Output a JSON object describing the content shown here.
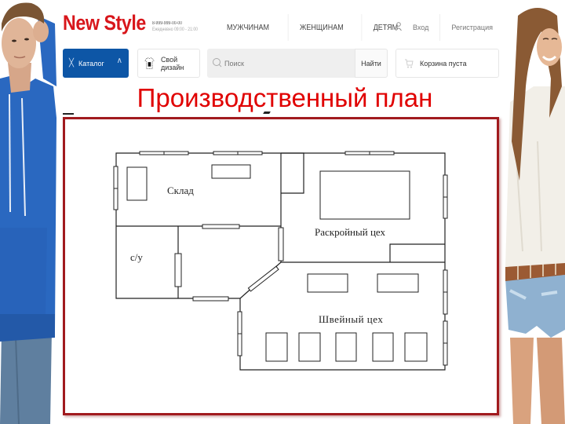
{
  "site": {
    "logo": "New Style",
    "phone": "8-999-999-00-00",
    "hours": "Ежедневно 09:00 - 21:00",
    "nav": [
      "МУЖЧИНАМ",
      "ЖЕНЩИНАМ",
      "ДЕТЯМ"
    ],
    "login_label": "Вход",
    "register_label": "Регистрация",
    "catalog_label": "Каталог",
    "design_label": "Свой дизайн",
    "search_placeholder": "Поиск",
    "search_button": "Найти",
    "cart_label": "Корзина пуста",
    "accent": "#d8161b",
    "catalog_bg": "#0d56a6"
  },
  "slide": {
    "title": "Производственный план",
    "title_color": "#e00000",
    "frame_color": "#a11a1e"
  },
  "plan": {
    "rooms": [
      {
        "id": "warehouse",
        "label": "Склад"
      },
      {
        "id": "cutting",
        "label": "Раскройный цех"
      },
      {
        "id": "wc",
        "label": "с/у"
      },
      {
        "id": "sewing",
        "label": "Швейный цех"
      }
    ]
  }
}
